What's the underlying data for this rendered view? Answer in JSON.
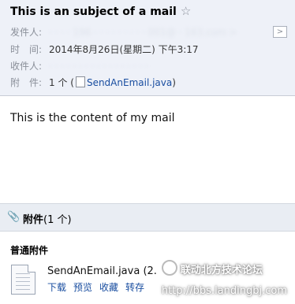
{
  "subject": "This is an subject of a mail",
  "meta": {
    "from_label": "发件人:",
    "from_value": "· · · · 196 · · · · · · · · · 001@ · 163.com >",
    "time_label": "时　间:",
    "time_value": "2014年8月26日(星期二) 下午3:17",
    "to_label": "收件人:",
    "to_value": "· · · · · · · · · · · · · · · · ·",
    "attach_label": "附　件:",
    "attach_count": "1 个 (",
    "attach_file": "SendAnEmail.java",
    "attach_close": ")"
  },
  "content": "This is the content of my mail",
  "attachments": {
    "header_title": "附件",
    "header_count": "(1 个)",
    "section_title": "普通附件",
    "file_name": "SendAnEmail.java",
    "file_size": "(2.",
    "actions": [
      "下载",
      "预览",
      "收藏",
      "转存"
    ]
  },
  "watermark": {
    "name": "联动北方技术论坛",
    "url": "http://bbs.landingbj.com"
  },
  "icons": {
    "star": "star-outline-icon",
    "expand": "chevron-right-icon",
    "file": "file-icon",
    "clip": "paperclip-icon",
    "doc": "document-icon"
  }
}
